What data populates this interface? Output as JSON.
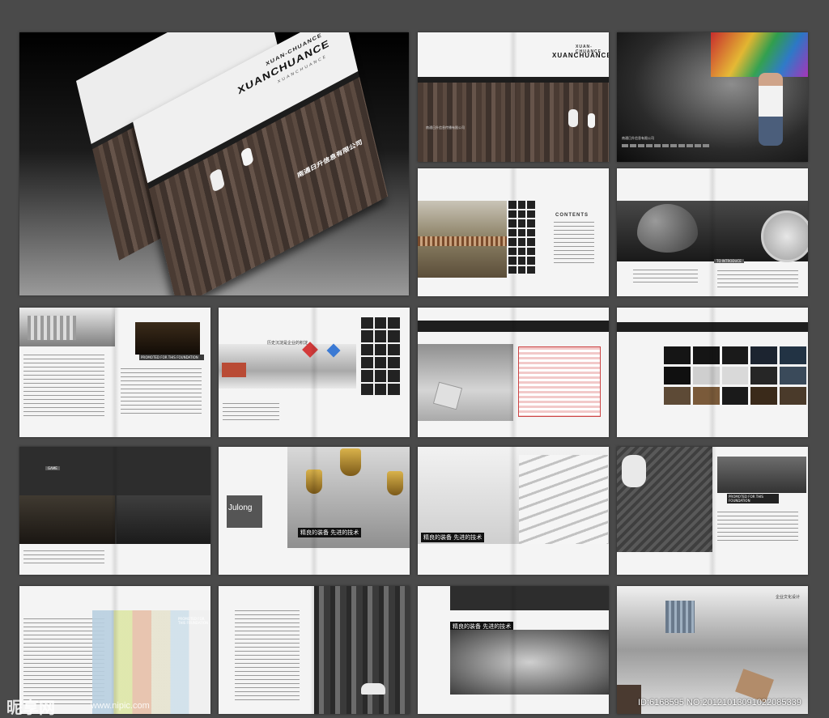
{
  "cover": {
    "brand_top": "XUAN-CHUANCE",
    "brand_main": "XUANCHUANCE",
    "tagline": "XUANCHUANCE",
    "company_cn": "南通日升信息有限公司"
  },
  "spread2": {
    "brand_top": "XUAN-CHUANCE",
    "brand_main": "XUANCHUANCE",
    "caption": "南通日升信息传播有限公司"
  },
  "spread3": {
    "caption": "南通日升信息有限公司"
  },
  "spread5": {
    "title": "CONTENTS"
  },
  "spread6": {
    "title": "TO INTRODUCE"
  },
  "spread7": {
    "promo": "PROMOTED FOR THIS FOUNDATION"
  },
  "spread8": {
    "headline": "历史沉淀是企业的积淀"
  },
  "spread12": {
    "section": "GAME"
  },
  "spread13": {
    "brand": "Julong",
    "slogan": "精良的装备 先进的技术"
  },
  "spread14": {
    "slogan": "精良的装备 先进的技术"
  },
  "spread15": {
    "promo": "PROMOTED FOR THIS FOUNDATION"
  },
  "spread16": {
    "promo": "PROMOTED FOR THIS FOUNDATION"
  },
  "spread18": {
    "slogan": "精良的装备 先进的技术"
  },
  "spread19": {
    "title": "企业文化设计"
  },
  "watermark": {
    "logo": "昵享网",
    "site": "www.nipic.com",
    "id": "ID:6168595 NO:20121013091022085339"
  }
}
